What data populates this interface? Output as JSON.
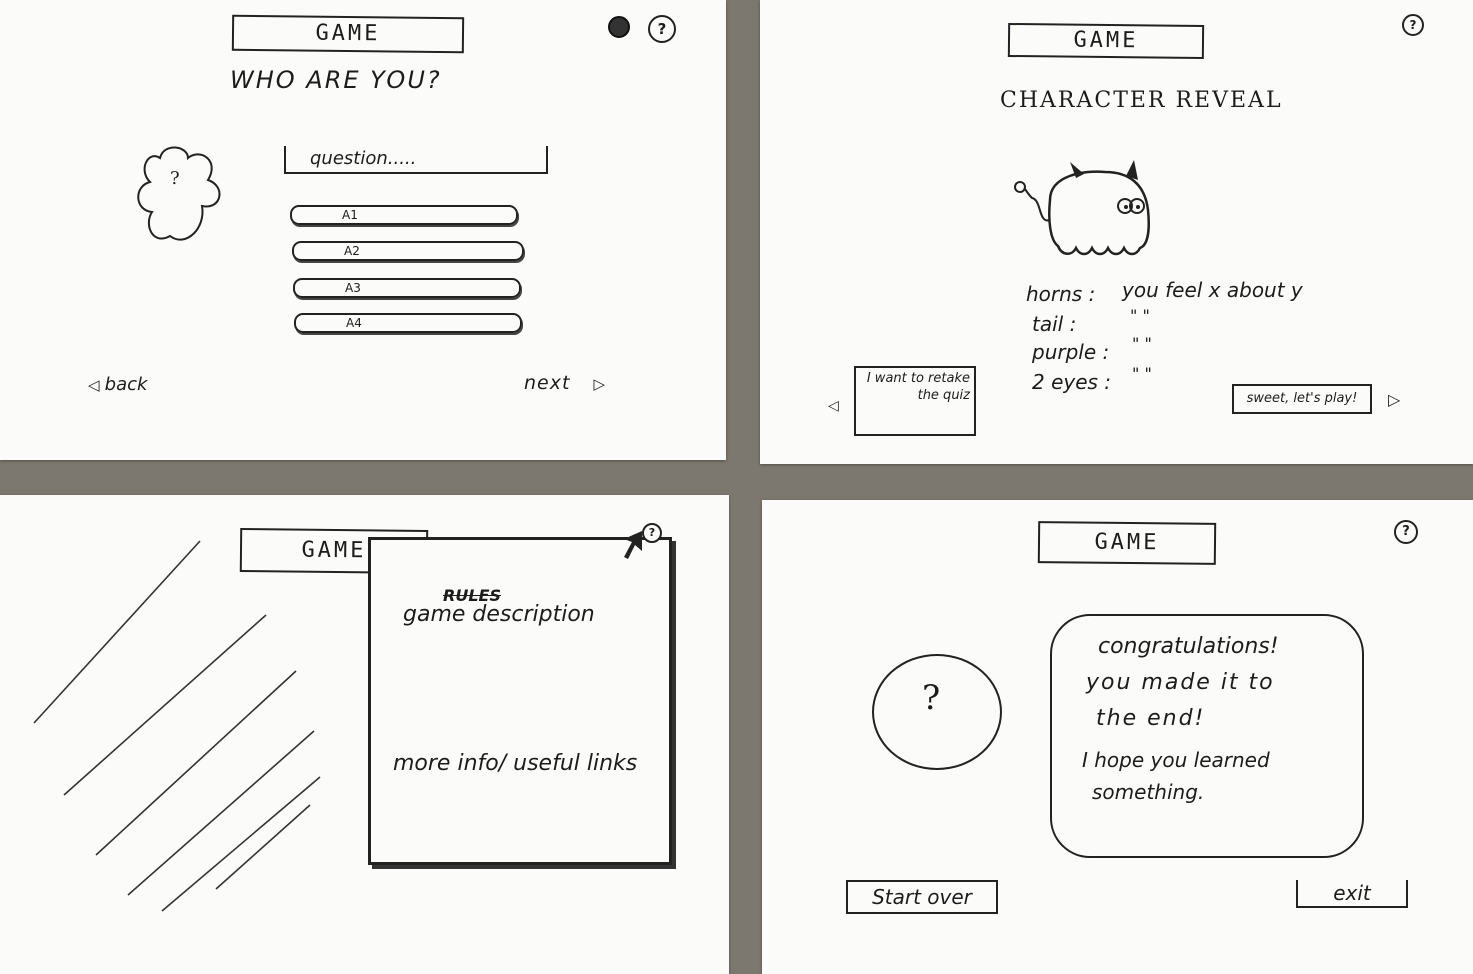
{
  "quiz": {
    "title": "GAME",
    "heading": "WHO ARE YOU?",
    "question": "question.....",
    "avatar_mark": "?",
    "help": "?",
    "answers": [
      "A1",
      "A2",
      "A3",
      "A4"
    ],
    "back": "back",
    "next": "next"
  },
  "reveal": {
    "title": "GAME",
    "heading": "CHARACTER REVEAL",
    "help": "?",
    "traits": [
      {
        "label": "horns :",
        "text": "you feel x about y"
      },
      {
        "label": "tail :",
        "text": "\"       \""
      },
      {
        "label": "purple :",
        "text": "\"       \""
      },
      {
        "label": "2 eyes :",
        "text": "\"       \""
      }
    ],
    "retake": "I want to retake the quiz",
    "play": "sweet, let's play!"
  },
  "info": {
    "title": "GAME",
    "struck_word": "RULES",
    "description": "game description",
    "more_info": "more info/ useful links",
    "help": "?"
  },
  "end": {
    "title": "GAME",
    "help": "?",
    "avatar_mark": "?",
    "message_lines": [
      "congratulations!",
      "you made it to",
      "the end!",
      "I hope you learned",
      "something."
    ],
    "start_over": "Start over",
    "exit": "exit"
  }
}
